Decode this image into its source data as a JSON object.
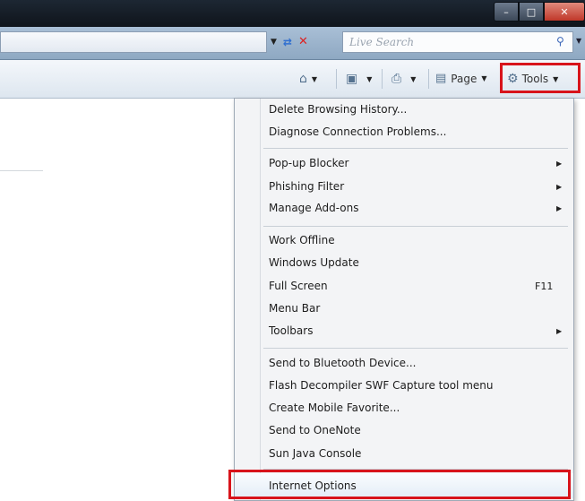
{
  "search": {
    "placeholder": "Live Search"
  },
  "commandbar": {
    "page_label": "Page",
    "tools_label": "Tools"
  },
  "menu": {
    "items": [
      {
        "label": "Delete Browsing History...",
        "shortcut": "",
        "submenu": false
      },
      {
        "label": "Diagnose Connection Problems...",
        "shortcut": "",
        "submenu": false
      },
      {
        "label": "Pop-up Blocker",
        "shortcut": "",
        "submenu": true
      },
      {
        "label": "Phishing Filter",
        "shortcut": "",
        "submenu": true
      },
      {
        "label": "Manage Add-ons",
        "shortcut": "",
        "submenu": true
      },
      {
        "label": "Work Offline",
        "shortcut": "",
        "submenu": false
      },
      {
        "label": "Windows Update",
        "shortcut": "",
        "submenu": false
      },
      {
        "label": "Full Screen",
        "shortcut": "F11",
        "submenu": false
      },
      {
        "label": "Menu Bar",
        "shortcut": "",
        "submenu": false
      },
      {
        "label": "Toolbars",
        "shortcut": "",
        "submenu": true
      },
      {
        "label": "Send to Bluetooth Device...",
        "shortcut": "",
        "submenu": false
      },
      {
        "label": "Flash Decompiler SWF Capture tool menu",
        "shortcut": "",
        "submenu": false
      },
      {
        "label": "Create Mobile Favorite...",
        "shortcut": "",
        "submenu": false
      },
      {
        "label": "Send to OneNote",
        "shortcut": "",
        "submenu": false
      },
      {
        "label": "Sun Java Console",
        "shortcut": "",
        "submenu": false
      },
      {
        "label": "Internet Options",
        "shortcut": "",
        "submenu": false
      }
    ]
  },
  "colors": {
    "highlight_box": "#d8141b",
    "menu_bg": "#f3f4f6"
  }
}
